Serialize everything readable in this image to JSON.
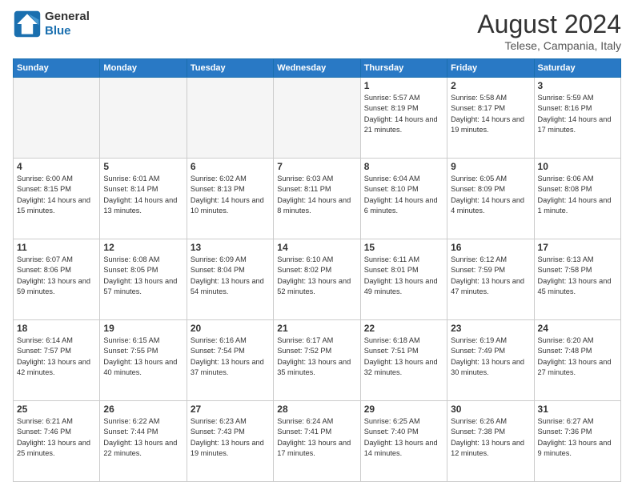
{
  "logo": {
    "line1": "General",
    "line2": "Blue"
  },
  "title": "August 2024",
  "location": "Telese, Campania, Italy",
  "days_of_week": [
    "Sunday",
    "Monday",
    "Tuesday",
    "Wednesday",
    "Thursday",
    "Friday",
    "Saturday"
  ],
  "weeks": [
    [
      {
        "day": "",
        "empty": true
      },
      {
        "day": "",
        "empty": true
      },
      {
        "day": "",
        "empty": true
      },
      {
        "day": "",
        "empty": true
      },
      {
        "day": "1",
        "sun": "5:57 AM",
        "set": "8:19 PM",
        "day_hours": "14 hours and 21 minutes."
      },
      {
        "day": "2",
        "sun": "5:58 AM",
        "set": "8:17 PM",
        "day_hours": "14 hours and 19 minutes."
      },
      {
        "day": "3",
        "sun": "5:59 AM",
        "set": "8:16 PM",
        "day_hours": "14 hours and 17 minutes."
      }
    ],
    [
      {
        "day": "4",
        "sun": "6:00 AM",
        "set": "8:15 PM",
        "day_hours": "14 hours and 15 minutes."
      },
      {
        "day": "5",
        "sun": "6:01 AM",
        "set": "8:14 PM",
        "day_hours": "14 hours and 13 minutes."
      },
      {
        "day": "6",
        "sun": "6:02 AM",
        "set": "8:13 PM",
        "day_hours": "14 hours and 10 minutes."
      },
      {
        "day": "7",
        "sun": "6:03 AM",
        "set": "8:11 PM",
        "day_hours": "14 hours and 8 minutes."
      },
      {
        "day": "8",
        "sun": "6:04 AM",
        "set": "8:10 PM",
        "day_hours": "14 hours and 6 minutes."
      },
      {
        "day": "9",
        "sun": "6:05 AM",
        "set": "8:09 PM",
        "day_hours": "14 hours and 4 minutes."
      },
      {
        "day": "10",
        "sun": "6:06 AM",
        "set": "8:08 PM",
        "day_hours": "14 hours and 1 minute."
      }
    ],
    [
      {
        "day": "11",
        "sun": "6:07 AM",
        "set": "8:06 PM",
        "day_hours": "13 hours and 59 minutes."
      },
      {
        "day": "12",
        "sun": "6:08 AM",
        "set": "8:05 PM",
        "day_hours": "13 hours and 57 minutes."
      },
      {
        "day": "13",
        "sun": "6:09 AM",
        "set": "8:04 PM",
        "day_hours": "13 hours and 54 minutes."
      },
      {
        "day": "14",
        "sun": "6:10 AM",
        "set": "8:02 PM",
        "day_hours": "13 hours and 52 minutes."
      },
      {
        "day": "15",
        "sun": "6:11 AM",
        "set": "8:01 PM",
        "day_hours": "13 hours and 49 minutes."
      },
      {
        "day": "16",
        "sun": "6:12 AM",
        "set": "7:59 PM",
        "day_hours": "13 hours and 47 minutes."
      },
      {
        "day": "17",
        "sun": "6:13 AM",
        "set": "7:58 PM",
        "day_hours": "13 hours and 45 minutes."
      }
    ],
    [
      {
        "day": "18",
        "sun": "6:14 AM",
        "set": "7:57 PM",
        "day_hours": "13 hours and 42 minutes."
      },
      {
        "day": "19",
        "sun": "6:15 AM",
        "set": "7:55 PM",
        "day_hours": "13 hours and 40 minutes."
      },
      {
        "day": "20",
        "sun": "6:16 AM",
        "set": "7:54 PM",
        "day_hours": "13 hours and 37 minutes."
      },
      {
        "day": "21",
        "sun": "6:17 AM",
        "set": "7:52 PM",
        "day_hours": "13 hours and 35 minutes."
      },
      {
        "day": "22",
        "sun": "6:18 AM",
        "set": "7:51 PM",
        "day_hours": "13 hours and 32 minutes."
      },
      {
        "day": "23",
        "sun": "6:19 AM",
        "set": "7:49 PM",
        "day_hours": "13 hours and 30 minutes."
      },
      {
        "day": "24",
        "sun": "6:20 AM",
        "set": "7:48 PM",
        "day_hours": "13 hours and 27 minutes."
      }
    ],
    [
      {
        "day": "25",
        "sun": "6:21 AM",
        "set": "7:46 PM",
        "day_hours": "13 hours and 25 minutes."
      },
      {
        "day": "26",
        "sun": "6:22 AM",
        "set": "7:44 PM",
        "day_hours": "13 hours and 22 minutes."
      },
      {
        "day": "27",
        "sun": "6:23 AM",
        "set": "7:43 PM",
        "day_hours": "13 hours and 19 minutes."
      },
      {
        "day": "28",
        "sun": "6:24 AM",
        "set": "7:41 PM",
        "day_hours": "13 hours and 17 minutes."
      },
      {
        "day": "29",
        "sun": "6:25 AM",
        "set": "7:40 PM",
        "day_hours": "13 hours and 14 minutes."
      },
      {
        "day": "30",
        "sun": "6:26 AM",
        "set": "7:38 PM",
        "day_hours": "13 hours and 12 minutes."
      },
      {
        "day": "31",
        "sun": "6:27 AM",
        "set": "7:36 PM",
        "day_hours": "13 hours and 9 minutes."
      }
    ]
  ],
  "labels": {
    "sunrise": "Sunrise:",
    "sunset": "Sunset:",
    "daylight": "Daylight:"
  }
}
